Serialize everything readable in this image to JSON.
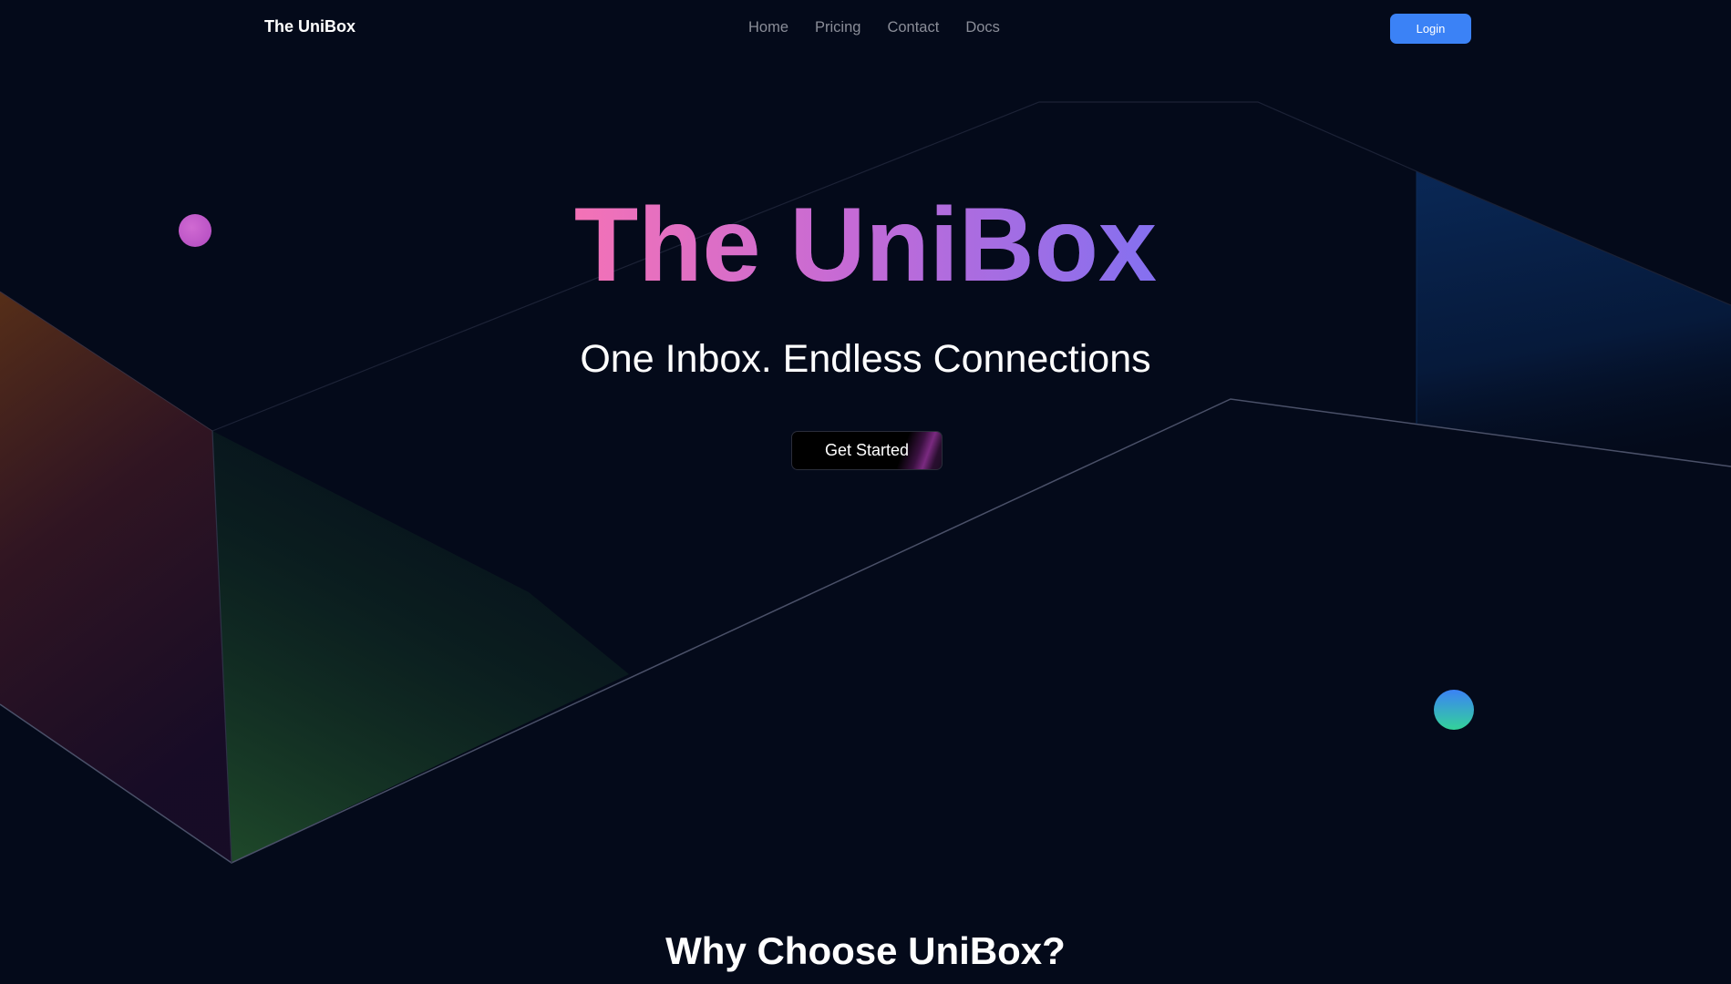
{
  "nav": {
    "brand": "The UniBox",
    "links": [
      "Home",
      "Pricing",
      "Contact",
      "Docs"
    ],
    "login_label": "Login"
  },
  "hero": {
    "title": "The UniBox",
    "subtitle": "One Inbox. Endless Connections",
    "cta_label": "Get Started"
  },
  "section": {
    "title": "Why Choose UniBox?"
  },
  "colors": {
    "background": "#040a1a",
    "accent_blue": "#3b82f6",
    "title_gradient_start": "#f472b6",
    "title_gradient_end": "#8b6cf0"
  }
}
